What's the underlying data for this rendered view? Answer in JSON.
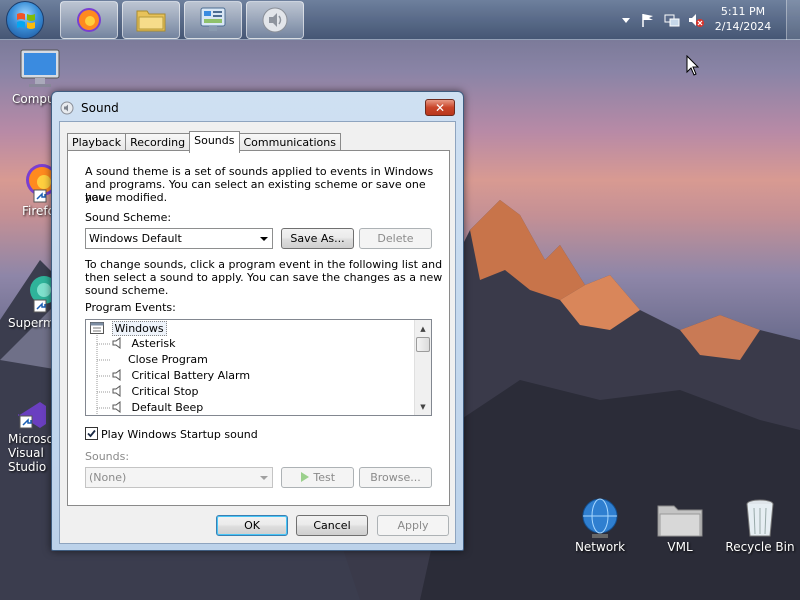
{
  "taskbar": {
    "start_label": "Start",
    "apps": [
      {
        "name": "firefox"
      },
      {
        "name": "file-explorer"
      },
      {
        "name": "control-panel"
      },
      {
        "name": "sound"
      }
    ],
    "clock_time": "5:11 PM",
    "clock_date": "2/14/2024"
  },
  "desktop": {
    "icons": [
      {
        "label": "Computer"
      },
      {
        "label": "Firefox"
      },
      {
        "label": "Supermium"
      },
      {
        "label": "Microsoft Visual Studio"
      },
      {
        "label": "Network"
      },
      {
        "label": "VML"
      },
      {
        "label": "Recycle Bin"
      }
    ]
  },
  "dialog": {
    "title": "Sound",
    "close_label": "✕",
    "tabs": [
      {
        "label": "Playback"
      },
      {
        "label": "Recording"
      },
      {
        "label": "Sounds"
      },
      {
        "label": "Communications"
      }
    ],
    "intro_line1": "A sound theme is a set of sounds applied to events in Windows",
    "intro_line2": "and programs.  You can select an existing scheme or save one you",
    "intro_line3": "have modified.",
    "scheme_label": "Sound Scheme:",
    "scheme_value": "Windows Default",
    "save_as_label": "Save As...",
    "delete_label": "Delete",
    "change_line1": "To change sounds, click a program event in the following list and",
    "change_line2": "then select a sound to apply.  You can save the changes as a new",
    "change_line3": "sound scheme.",
    "events_label": "Program Events:",
    "events": [
      {
        "label": "Windows",
        "level": 0,
        "has_sound": false
      },
      {
        "label": "Asterisk",
        "level": 1,
        "has_sound": true
      },
      {
        "label": "Close Program",
        "level": 1,
        "has_sound": false
      },
      {
        "label": "Critical Battery Alarm",
        "level": 1,
        "has_sound": true
      },
      {
        "label": "Critical Stop",
        "level": 1,
        "has_sound": true
      },
      {
        "label": "Default Beep",
        "level": 1,
        "has_sound": true
      }
    ],
    "startup_label": "Play Windows Startup sound",
    "startup_checked": true,
    "sounds_label": "Sounds:",
    "sounds_value": "(None)",
    "test_label": "Test",
    "browse_label": "Browse...",
    "ok_label": "OK",
    "cancel_label": "Cancel",
    "apply_label": "Apply"
  }
}
